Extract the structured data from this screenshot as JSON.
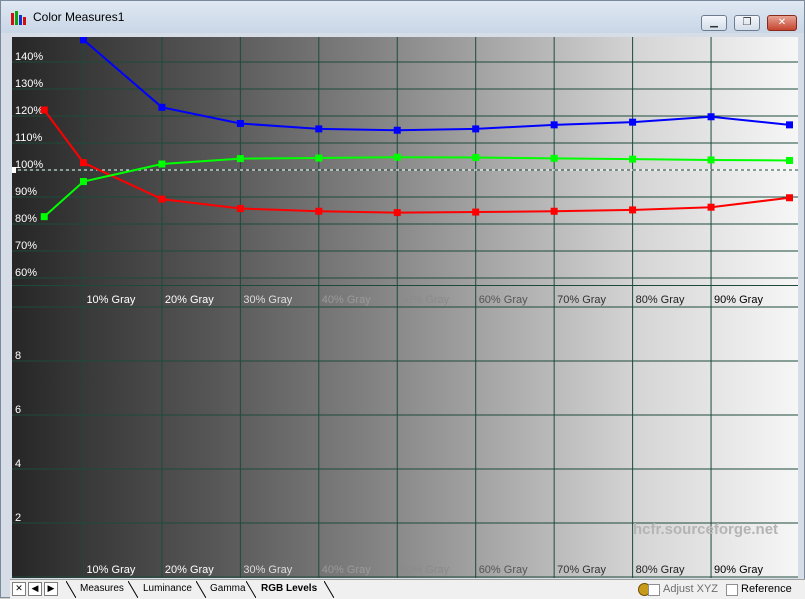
{
  "window": {
    "title": "Color Measures1"
  },
  "chart_data": {
    "type": "line",
    "categories": [
      "10% Gray",
      "20% Gray",
      "30% Gray",
      "40% Gray",
      "50% Gray",
      "60% Gray",
      "70% Gray",
      "80% Gray",
      "90% Gray"
    ],
    "x": [
      5,
      10,
      20,
      30,
      40,
      50,
      60,
      70,
      80,
      90,
      100
    ],
    "top_ytick_labels": [
      "140%",
      "130%",
      "120%",
      "110%",
      "100%",
      "90%",
      "80%",
      "70%",
      "60%"
    ],
    "top_ytick_values": [
      140,
      130,
      120,
      110,
      100,
      90,
      80,
      70,
      60
    ],
    "bottom_ytick_labels": [
      "8",
      "6",
      "4",
      "2"
    ],
    "bottom_ytick_values": [
      8,
      6,
      4,
      2
    ],
    "reference_level": 100,
    "series": [
      {
        "color": "#0000ff",
        "values": [
          null,
          146,
          121,
          115,
          113,
          112.5,
          113,
          114.5,
          115.5,
          117.5,
          114.5
        ]
      },
      {
        "color": "#ff0000",
        "values": [
          120,
          100.5,
          87,
          83.5,
          82.5,
          82,
          82.2,
          82.5,
          83,
          84,
          87.5
        ]
      },
      {
        "color": "#00ff00",
        "values": [
          80.5,
          93.5,
          100,
          102,
          102.2,
          102.5,
          102.4,
          102.1,
          101.8,
          101.5,
          101.3
        ]
      }
    ],
    "watermark": "hcfr.sourceforge.net"
  },
  "tabs": [
    {
      "label": "Measures"
    },
    {
      "label": "Luminance"
    },
    {
      "label": "Gamma"
    },
    {
      "label": "RGB Levels"
    }
  ],
  "status": {
    "adjust_label": "Adjust XYZ",
    "reference_label": "Reference"
  },
  "nav": {
    "close": "✕",
    "prev": "◀",
    "next": "▶"
  },
  "colors": {
    "titlebar": "#dfe8f3",
    "close_button": "#c4442e"
  }
}
